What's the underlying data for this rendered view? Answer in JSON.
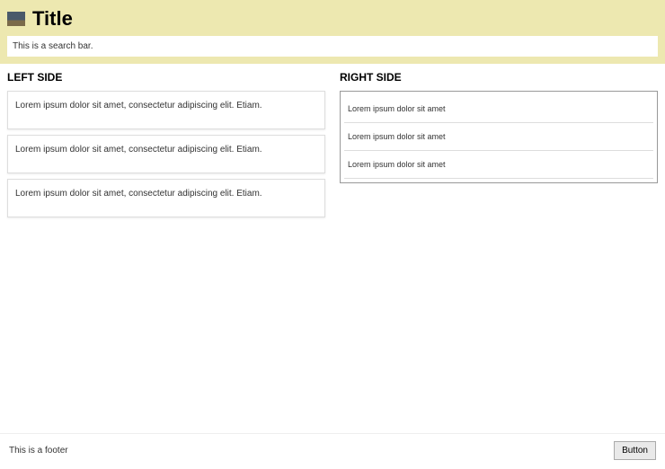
{
  "header": {
    "title": "Title",
    "search_placeholder": "This is a search bar."
  },
  "left": {
    "heading": "LEFT SIDE",
    "cards": [
      {
        "text": "Lorem ipsum dolor sit amet, consectetur adipiscing elit. Etiam."
      },
      {
        "text": "Lorem ipsum dolor sit amet, consectetur adipiscing elit. Etiam."
      },
      {
        "text": "Lorem ipsum dolor sit amet, consectetur adipiscing elit. Etiam."
      }
    ]
  },
  "right": {
    "heading": "RIGHT SIDE",
    "items": [
      {
        "text": "Lorem ipsum dolor sit amet"
      },
      {
        "text": "Lorem ipsum dolor sit amet"
      },
      {
        "text": "Lorem ipsum dolor sit amet"
      }
    ]
  },
  "footer": {
    "text": "This is a footer",
    "button_label": "Button"
  }
}
